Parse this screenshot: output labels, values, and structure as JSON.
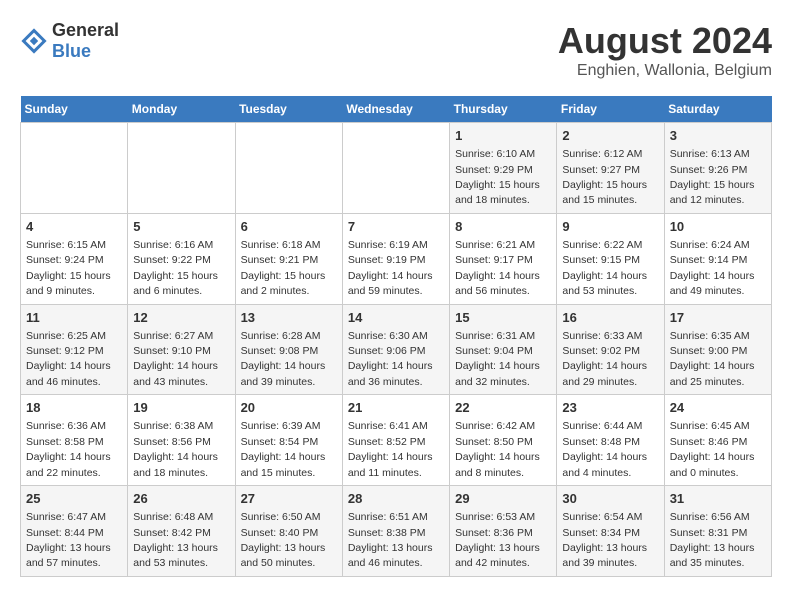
{
  "logo": {
    "general": "General",
    "blue": "Blue"
  },
  "title": "August 2024",
  "subtitle": "Enghien, Wallonia, Belgium",
  "days_header": [
    "Sunday",
    "Monday",
    "Tuesday",
    "Wednesday",
    "Thursday",
    "Friday",
    "Saturday"
  ],
  "weeks": [
    [
      {
        "day": "",
        "content": ""
      },
      {
        "day": "",
        "content": ""
      },
      {
        "day": "",
        "content": ""
      },
      {
        "day": "",
        "content": ""
      },
      {
        "day": "1",
        "content": "Sunrise: 6:10 AM\nSunset: 9:29 PM\nDaylight: 15 hours\nand 18 minutes."
      },
      {
        "day": "2",
        "content": "Sunrise: 6:12 AM\nSunset: 9:27 PM\nDaylight: 15 hours\nand 15 minutes."
      },
      {
        "day": "3",
        "content": "Sunrise: 6:13 AM\nSunset: 9:26 PM\nDaylight: 15 hours\nand 12 minutes."
      }
    ],
    [
      {
        "day": "4",
        "content": "Sunrise: 6:15 AM\nSunset: 9:24 PM\nDaylight: 15 hours\nand 9 minutes."
      },
      {
        "day": "5",
        "content": "Sunrise: 6:16 AM\nSunset: 9:22 PM\nDaylight: 15 hours\nand 6 minutes."
      },
      {
        "day": "6",
        "content": "Sunrise: 6:18 AM\nSunset: 9:21 PM\nDaylight: 15 hours\nand 2 minutes."
      },
      {
        "day": "7",
        "content": "Sunrise: 6:19 AM\nSunset: 9:19 PM\nDaylight: 14 hours\nand 59 minutes."
      },
      {
        "day": "8",
        "content": "Sunrise: 6:21 AM\nSunset: 9:17 PM\nDaylight: 14 hours\nand 56 minutes."
      },
      {
        "day": "9",
        "content": "Sunrise: 6:22 AM\nSunset: 9:15 PM\nDaylight: 14 hours\nand 53 minutes."
      },
      {
        "day": "10",
        "content": "Sunrise: 6:24 AM\nSunset: 9:14 PM\nDaylight: 14 hours\nand 49 minutes."
      }
    ],
    [
      {
        "day": "11",
        "content": "Sunrise: 6:25 AM\nSunset: 9:12 PM\nDaylight: 14 hours\nand 46 minutes."
      },
      {
        "day": "12",
        "content": "Sunrise: 6:27 AM\nSunset: 9:10 PM\nDaylight: 14 hours\nand 43 minutes."
      },
      {
        "day": "13",
        "content": "Sunrise: 6:28 AM\nSunset: 9:08 PM\nDaylight: 14 hours\nand 39 minutes."
      },
      {
        "day": "14",
        "content": "Sunrise: 6:30 AM\nSunset: 9:06 PM\nDaylight: 14 hours\nand 36 minutes."
      },
      {
        "day": "15",
        "content": "Sunrise: 6:31 AM\nSunset: 9:04 PM\nDaylight: 14 hours\nand 32 minutes."
      },
      {
        "day": "16",
        "content": "Sunrise: 6:33 AM\nSunset: 9:02 PM\nDaylight: 14 hours\nand 29 minutes."
      },
      {
        "day": "17",
        "content": "Sunrise: 6:35 AM\nSunset: 9:00 PM\nDaylight: 14 hours\nand 25 minutes."
      }
    ],
    [
      {
        "day": "18",
        "content": "Sunrise: 6:36 AM\nSunset: 8:58 PM\nDaylight: 14 hours\nand 22 minutes."
      },
      {
        "day": "19",
        "content": "Sunrise: 6:38 AM\nSunset: 8:56 PM\nDaylight: 14 hours\nand 18 minutes."
      },
      {
        "day": "20",
        "content": "Sunrise: 6:39 AM\nSunset: 8:54 PM\nDaylight: 14 hours\nand 15 minutes."
      },
      {
        "day": "21",
        "content": "Sunrise: 6:41 AM\nSunset: 8:52 PM\nDaylight: 14 hours\nand 11 minutes."
      },
      {
        "day": "22",
        "content": "Sunrise: 6:42 AM\nSunset: 8:50 PM\nDaylight: 14 hours\nand 8 minutes."
      },
      {
        "day": "23",
        "content": "Sunrise: 6:44 AM\nSunset: 8:48 PM\nDaylight: 14 hours\nand 4 minutes."
      },
      {
        "day": "24",
        "content": "Sunrise: 6:45 AM\nSunset: 8:46 PM\nDaylight: 14 hours\nand 0 minutes."
      }
    ],
    [
      {
        "day": "25",
        "content": "Sunrise: 6:47 AM\nSunset: 8:44 PM\nDaylight: 13 hours\nand 57 minutes."
      },
      {
        "day": "26",
        "content": "Sunrise: 6:48 AM\nSunset: 8:42 PM\nDaylight: 13 hours\nand 53 minutes."
      },
      {
        "day": "27",
        "content": "Sunrise: 6:50 AM\nSunset: 8:40 PM\nDaylight: 13 hours\nand 50 minutes."
      },
      {
        "day": "28",
        "content": "Sunrise: 6:51 AM\nSunset: 8:38 PM\nDaylight: 13 hours\nand 46 minutes."
      },
      {
        "day": "29",
        "content": "Sunrise: 6:53 AM\nSunset: 8:36 PM\nDaylight: 13 hours\nand 42 minutes."
      },
      {
        "day": "30",
        "content": "Sunrise: 6:54 AM\nSunset: 8:34 PM\nDaylight: 13 hours\nand 39 minutes."
      },
      {
        "day": "31",
        "content": "Sunrise: 6:56 AM\nSunset: 8:31 PM\nDaylight: 13 hours\nand 35 minutes."
      }
    ]
  ]
}
